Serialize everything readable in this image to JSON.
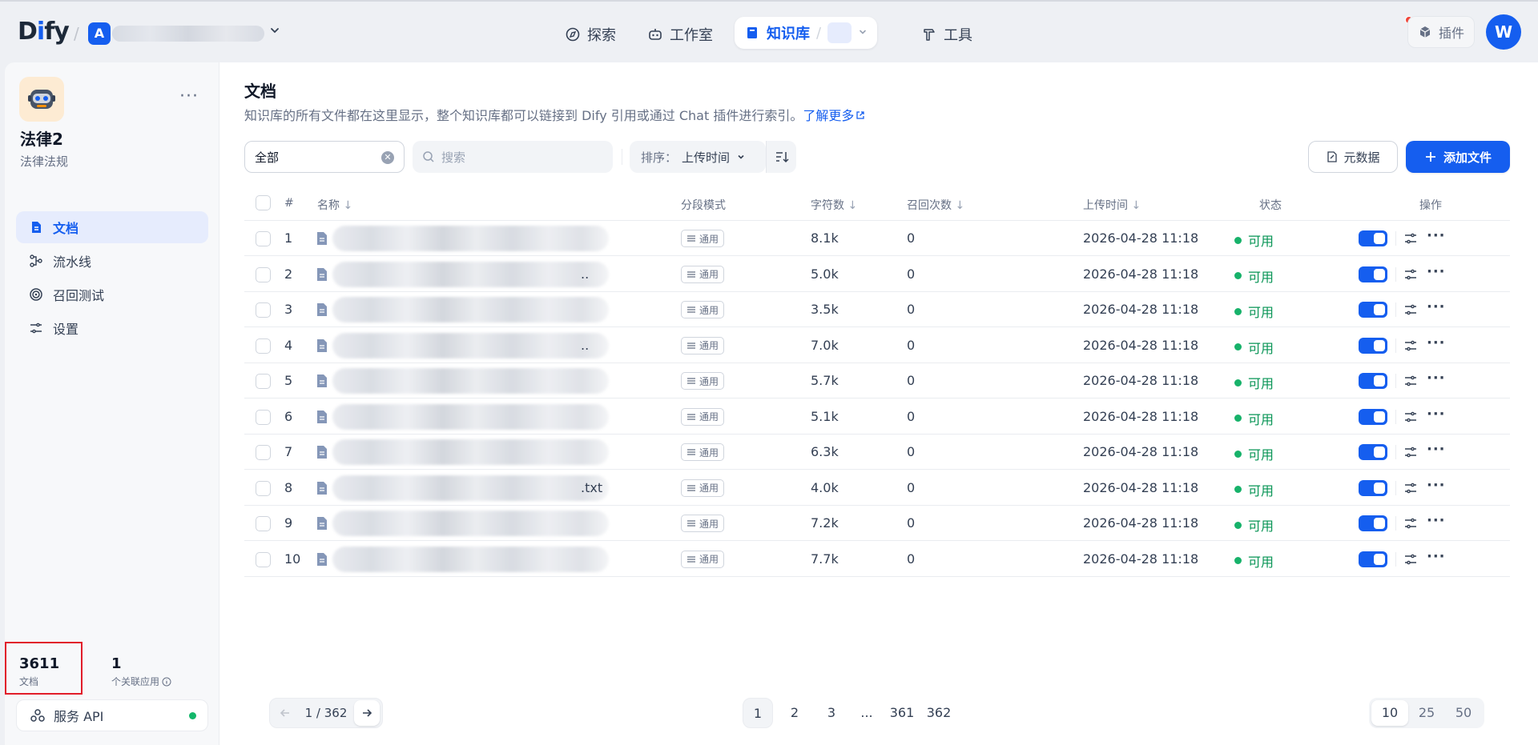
{
  "app": {
    "logo_prefix": "D",
    "logo_i": "i",
    "logo_suffix": "fy",
    "workspace_initial": "A"
  },
  "nav": {
    "explore": "探索",
    "studio": "工作室",
    "knowledge": "知识库",
    "tools": "工具",
    "plugins": "插件",
    "user_initial": "W"
  },
  "sidebar": {
    "dataset_name": "法律2",
    "dataset_desc": "法律法规",
    "items": [
      {
        "label": "文档",
        "icon": "document-icon"
      },
      {
        "label": "流水线",
        "icon": "pipeline-icon"
      },
      {
        "label": "召回测试",
        "icon": "target-icon"
      },
      {
        "label": "设置",
        "icon": "settings-icon"
      }
    ],
    "stats": {
      "doc_count": "3611",
      "doc_label": "文档",
      "app_count": "1",
      "app_label": "个关联应用"
    },
    "api_label": "服务 API"
  },
  "main": {
    "title": "文档",
    "description": "知识库的所有文件都在这里显示，整个知识库都可以链接到 Dify 引用或通过 Chat 插件进行索引。",
    "learn_more": "了解更多",
    "filter_value": "全部",
    "search_placeholder": "搜索",
    "sort_label": "排序：",
    "sort_value": "上传时间",
    "metadata_btn": "元数据",
    "add_btn": "添加文件",
    "columns": {
      "index": "#",
      "name": "名称",
      "mode": "分段模式",
      "chars": "字符数",
      "hits": "召回次数",
      "uploaded": "上传时间",
      "status": "状态",
      "actions": "操作"
    },
    "rows": [
      {
        "index": "1",
        "name_suffix": "",
        "mode": "通用",
        "chars": "8.1k",
        "hits": "0",
        "uploaded": "2026-04-28 11:18",
        "status": "可用"
      },
      {
        "index": "2",
        "name_suffix": "..",
        "mode": "通用",
        "chars": "5.0k",
        "hits": "0",
        "uploaded": "2026-04-28 11:18",
        "status": "可用"
      },
      {
        "index": "3",
        "name_suffix": "",
        "mode": "通用",
        "chars": "3.5k",
        "hits": "0",
        "uploaded": "2026-04-28 11:18",
        "status": "可用"
      },
      {
        "index": "4",
        "name_suffix": "..",
        "mode": "通用",
        "chars": "7.0k",
        "hits": "0",
        "uploaded": "2026-04-28 11:18",
        "status": "可用"
      },
      {
        "index": "5",
        "name_suffix": "",
        "mode": "通用",
        "chars": "5.7k",
        "hits": "0",
        "uploaded": "2026-04-28 11:18",
        "status": "可用"
      },
      {
        "index": "6",
        "name_suffix": "",
        "mode": "通用",
        "chars": "5.1k",
        "hits": "0",
        "uploaded": "2026-04-28 11:18",
        "status": "可用"
      },
      {
        "index": "7",
        "name_suffix": "",
        "mode": "通用",
        "chars": "6.3k",
        "hits": "0",
        "uploaded": "2026-04-28 11:18",
        "status": "可用"
      },
      {
        "index": "8",
        "name_suffix": ".txt",
        "mode": "通用",
        "chars": "4.0k",
        "hits": "0",
        "uploaded": "2026-04-28 11:18",
        "status": "可用"
      },
      {
        "index": "9",
        "name_suffix": "",
        "mode": "通用",
        "chars": "7.2k",
        "hits": "0",
        "uploaded": "2026-04-28 11:18",
        "status": "可用"
      },
      {
        "index": "10",
        "name_suffix": "",
        "mode": "通用",
        "chars": "7.7k",
        "hits": "0",
        "uploaded": "2026-04-28 11:18",
        "status": "可用"
      }
    ],
    "pagination": {
      "current": "1",
      "total": "362",
      "pages": [
        "1",
        "2",
        "3",
        "...",
        "361",
        "362"
      ],
      "sizes": [
        "10",
        "25",
        "50"
      ],
      "active_size": "10"
    }
  },
  "colors": {
    "accent": "#155eef",
    "success": "#17b26a",
    "danger": "#e11d2a"
  }
}
